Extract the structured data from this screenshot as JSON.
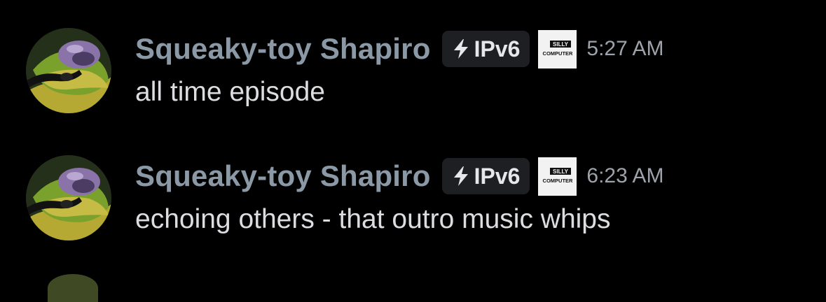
{
  "messages": [
    {
      "username": "Squeaky-toy Shapiro",
      "tag": {
        "icon": "lightning-bolt-icon",
        "label": "IPv6"
      },
      "badge": {
        "icon": "server-badge-icon",
        "text_lines": [
          "SILLY",
          "COMPUTER"
        ]
      },
      "timestamp": "5:27 AM",
      "content": "all time episode"
    },
    {
      "username": "Squeaky-toy Shapiro",
      "tag": {
        "icon": "lightning-bolt-icon",
        "label": "IPv6"
      },
      "badge": {
        "icon": "server-badge-icon",
        "text_lines": [
          "SILLY",
          "COMPUTER"
        ]
      },
      "timestamp": "6:23 AM",
      "content": "echoing others - that outro music whips"
    }
  ],
  "colors": {
    "background": "#000000",
    "username": "#8b98a6",
    "message_text": "#dcdde1",
    "timestamp": "#9ea3ab",
    "tag_background": "#1e1f22"
  }
}
